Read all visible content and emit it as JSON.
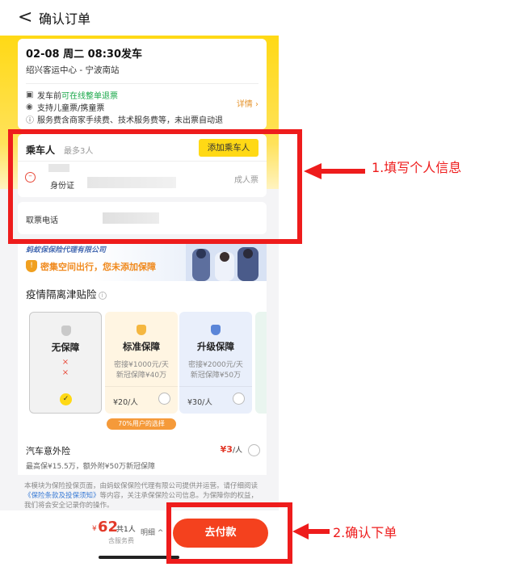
{
  "header": {
    "back_glyph": "<",
    "title": "确认订单"
  },
  "trip": {
    "time": "02-08 周二 08:30发车",
    "route": "绍兴客运中心 - 宁波南站",
    "refund_prefix": "发车前",
    "refund_highlight": "可在线整单退票",
    "child_policy": "支持儿童票/携童票",
    "fee_note": "服务费含商家手续费、技术服务费等，未出票自动退",
    "detail_label": "详情",
    "accent_color": "#1aa84a"
  },
  "passengers": {
    "title": "乘车人",
    "limit": "最多3人",
    "add_label": "添加乘车人",
    "items": [
      {
        "id_label": "身份证",
        "ticket_type": "成人票"
      }
    ]
  },
  "contact": {
    "label": "取票电话"
  },
  "insurance": {
    "company": "蚂蚁保保险代理有限公司",
    "warning": "密集空间出行，您未添加保障",
    "section_title": "疫情隔离津贴险",
    "plans": [
      {
        "name": "无保障",
        "marks": [
          "×",
          "×"
        ],
        "selected": true
      },
      {
        "name": "标准保障",
        "line1": "密接¥1000元/天",
        "line2": "新冠保障¥40万",
        "price": "¥20/人"
      },
      {
        "name": "升级保障",
        "line1": "密接¥2000元/天",
        "line2": "新冠保障¥50万",
        "price": "¥30/人"
      }
    ],
    "popular_tag": "70%用户的选择",
    "bus_title": "汽车意外险",
    "bus_desc": "最高保¥15.5万，额外附¥50万新冠保障",
    "bus_price": "¥3",
    "bus_price_unit": "/人"
  },
  "disclaimer": {
    "part1": "本模块为保险投保页面，由蚂蚁保保险代理有限公司提供并运营。请仔细阅读",
    "link": "《保险条款及投保须知》",
    "part2": "等内容，关注承保保险公司信息。为保障你的权益，我们将会安全记录你的操作。"
  },
  "footer": {
    "currency": "¥",
    "total": "62",
    "count": "共1人",
    "fee_note": "含服务费",
    "detail_toggle": "明细 ^",
    "pay_label": "去付款"
  },
  "annotations": {
    "step1": "1.填写个人信息",
    "step2": "2.确认下单",
    "color": "#ee1c1c"
  }
}
